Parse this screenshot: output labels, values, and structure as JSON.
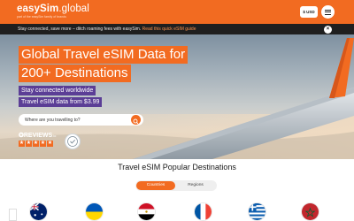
{
  "header": {
    "logo_bold": "easySim",
    "logo_light": ".global",
    "logo_tagline": "part of the easySim family of brands",
    "currency": "$ USD",
    "menu_icon": "hamburger-icon"
  },
  "notice": {
    "text": "Stay connected, save more – ditch roaming fees with easySim. ",
    "link": "Read this quick eSIM guide",
    "close_icon": "close-icon"
  },
  "hero": {
    "title_line1": "Global Travel eSIM Data for",
    "title_line2": "200+ Destinations",
    "tag1": "Stay connected worldwide",
    "tag2": "Travel eSIM data from $3.99",
    "search_placeholder": "Where are you travelling to?",
    "reviews_brand": "REVIEWS",
    "reviews_suffix": ".io",
    "rating_stars": 5
  },
  "section": {
    "title": "Travel eSIM Popular Destinations",
    "tabs": [
      "Countries",
      "Regions"
    ],
    "active_tab": "Countries"
  },
  "colors": {
    "brand": "#f26b21",
    "accent_purple": "#5b3e96",
    "notice_bg": "#1f1f1f"
  },
  "flags": [
    "australia-flag",
    "ukraine-flag",
    "egypt-flag",
    "france-flag",
    "greece-flag",
    "morocco-flag"
  ]
}
